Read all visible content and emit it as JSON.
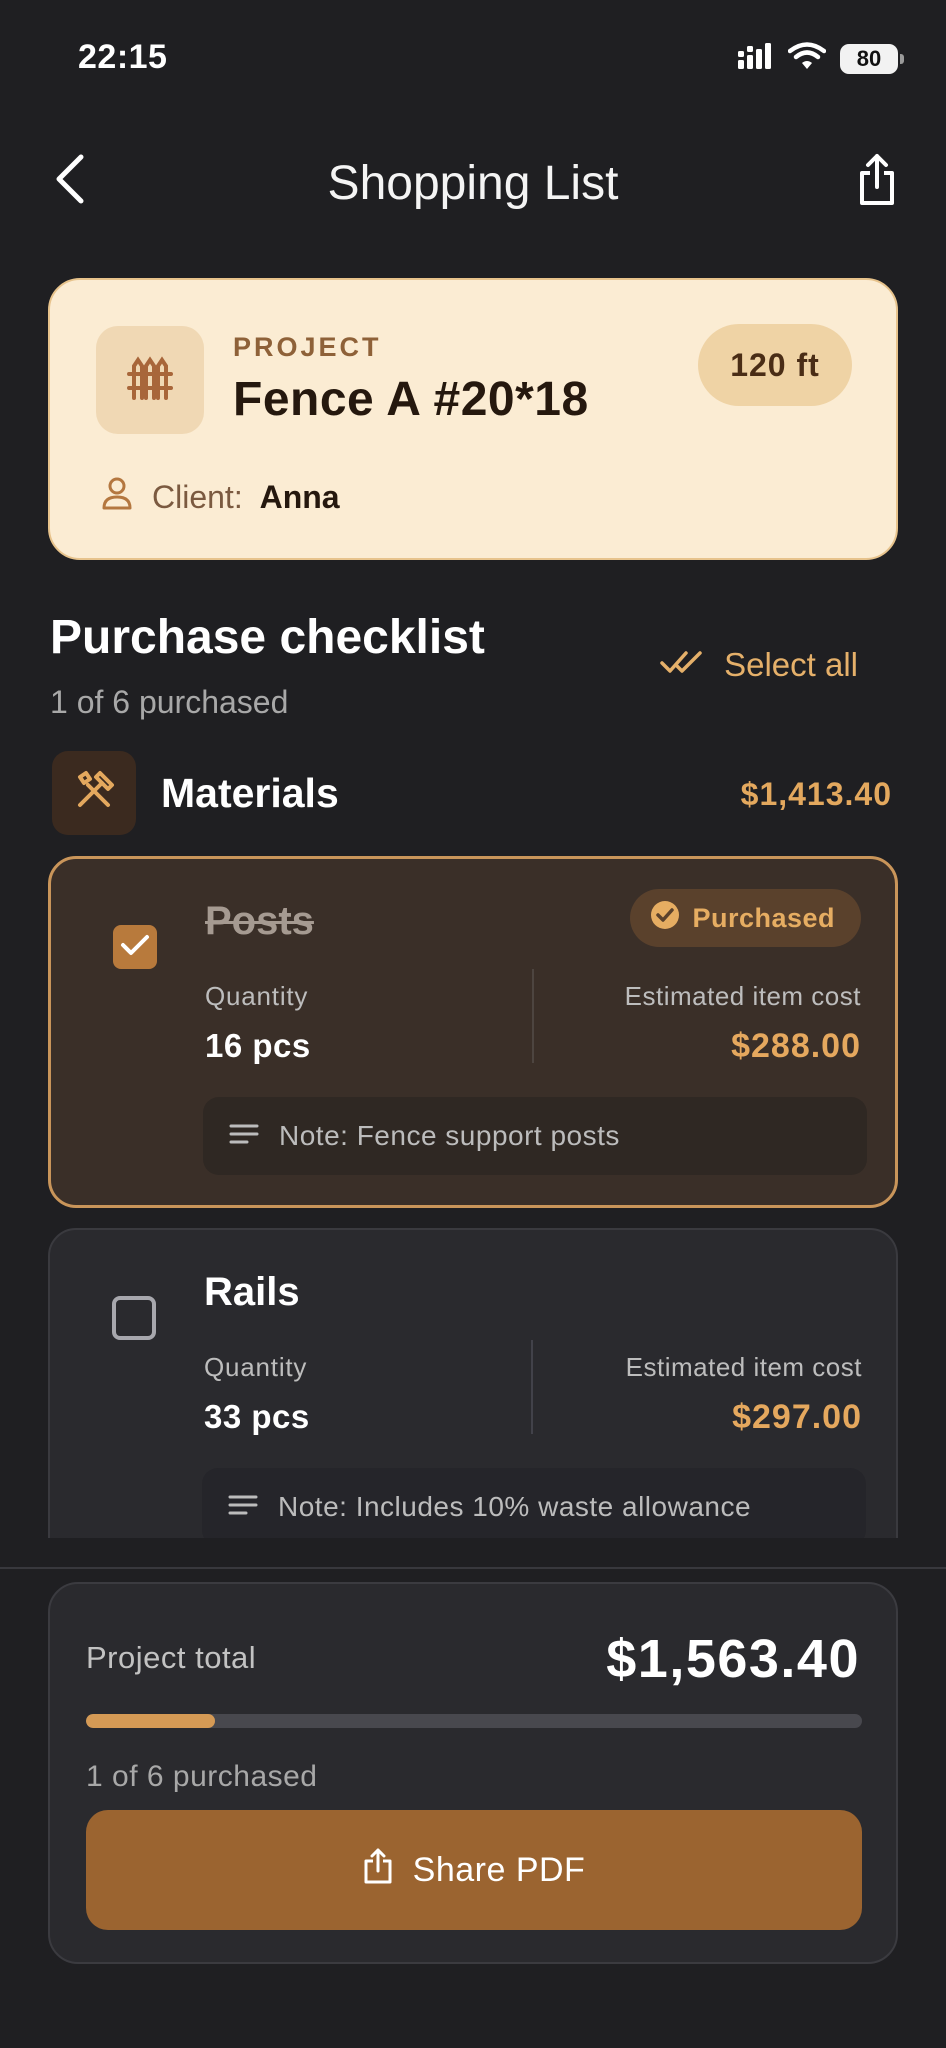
{
  "status_bar": {
    "time": "22:15",
    "battery": "80"
  },
  "nav": {
    "title": "Shopping List",
    "back_icon": "chevron-left-icon",
    "share_icon": "share-icon"
  },
  "project": {
    "label": "PROJECT",
    "name": "Fence A #20*18",
    "length": "120 ft",
    "client_label": "Client:",
    "client_name": "Anna"
  },
  "checklist": {
    "title": "Purchase checklist",
    "subtitle": "1 of 6 purchased",
    "select_all": "Select all"
  },
  "category": {
    "name": "Materials",
    "total": "$1,413.40"
  },
  "items": [
    {
      "name": "Posts",
      "purchased": true,
      "badge": "Purchased",
      "quantity_label": "Quantity",
      "quantity": "16 pcs",
      "cost_label": "Estimated item cost",
      "cost": "$288.00",
      "note": "Note: Fence support posts"
    },
    {
      "name": "Rails",
      "purchased": false,
      "quantity_label": "Quantity",
      "quantity": "33 pcs",
      "cost_label": "Estimated item cost",
      "cost": "$297.00",
      "note": "Note: Includes 10% waste allowance"
    }
  ],
  "summary": {
    "total_label": "Project total",
    "total": "$1,563.40",
    "progress_fraction": 0.1667,
    "progress_text": "1 of 6 purchased",
    "share_button": "Share PDF"
  },
  "colors": {
    "accent": "#e5a85e",
    "button": "#9b6430",
    "card": "#fbecd3",
    "background": "#1f1f22"
  }
}
